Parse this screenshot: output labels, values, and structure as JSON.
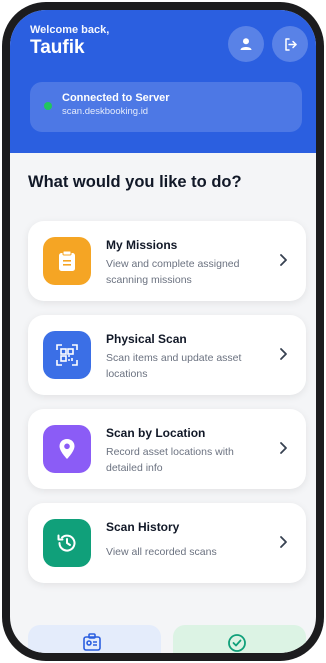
{
  "header": {
    "welcome": "Welcome back,",
    "username": "Taufik",
    "profile_icon": "person-icon",
    "logout_icon": "logout-icon"
  },
  "server": {
    "title": "Connected to Server",
    "host": "scan.deskbooking.id",
    "status_color": "#22c55e"
  },
  "question": "What would you like to do?",
  "cards": [
    {
      "title": "My Missions",
      "desc": "View and complete assigned scanning missions",
      "icon": "clipboard-icon",
      "color": "#f5a524"
    },
    {
      "title": "Physical Scan",
      "desc": "Scan items and update asset locations",
      "icon": "qr-scan-icon",
      "color": "#3b6fe6"
    },
    {
      "title": "Scan by Location",
      "desc": "Record asset locations with detailed info",
      "icon": "location-pin-icon",
      "color": "#8b5cf6"
    },
    {
      "title": "Scan History",
      "desc": "View all recorded scans",
      "icon": "history-icon",
      "color": "#10a07a"
    }
  ],
  "bottom": {
    "left_icon": "id-badge-icon",
    "right_icon": "check-circle-icon"
  },
  "colors": {
    "primary": "#2b5fe0",
    "background": "#f4f5f7"
  }
}
